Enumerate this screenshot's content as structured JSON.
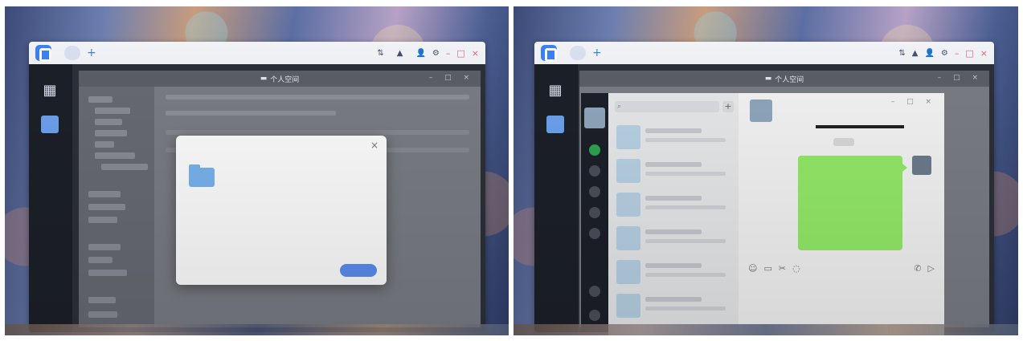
{
  "left_screenshot": {
    "app": {
      "brand": "",
      "tab_label": "",
      "toolbar_text_1": "",
      "toolbar_text_2": ""
    },
    "file_window": {
      "title": "个人空间"
    },
    "share_dialog": {
      "title": "",
      "folder_name": "",
      "link_text": "",
      "copy_link_label": "",
      "confirm_button": ""
    }
  },
  "right_screenshot": {
    "app": {
      "brand": "",
      "tab_label": ""
    },
    "file_window": {
      "title": "个人空间"
    },
    "chat": {
      "search_placeholder": "",
      "message_text": "",
      "send_button": ""
    }
  },
  "colors": {
    "accent": "#3b82f6",
    "chat_bubble": "#95ec69",
    "dialog_button": "#5b8def"
  }
}
